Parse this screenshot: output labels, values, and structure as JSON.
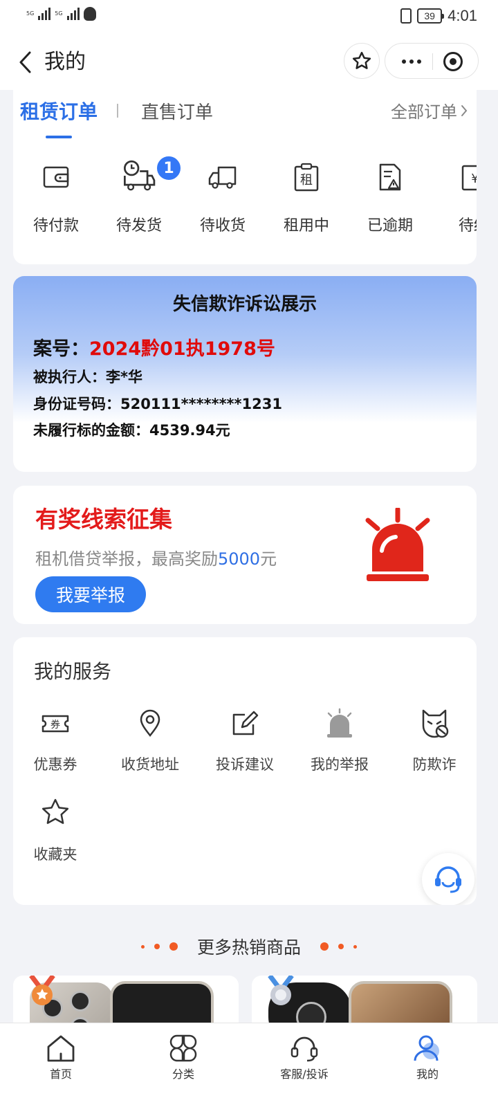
{
  "status_bar": {
    "net_tags": [
      "5G",
      "5G"
    ],
    "battery": "39",
    "time": "4:01"
  },
  "nav": {
    "title": "我的"
  },
  "orders": {
    "tabs": [
      "租赁订单",
      "直售订单"
    ],
    "all_orders_label": "全部订单",
    "items": [
      {
        "label": "待付款",
        "icon": "wallet-icon"
      },
      {
        "label": "待发货",
        "icon": "truck-clock-icon",
        "badge": "1"
      },
      {
        "label": "待收货",
        "icon": "truck-icon"
      },
      {
        "label": "租用中",
        "icon": "rent-clipboard-icon",
        "glyph": "租"
      },
      {
        "label": "已逾期",
        "icon": "overdue-document-icon"
      },
      {
        "label": "待结",
        "icon": "settlement-icon"
      }
    ]
  },
  "credit": {
    "title": "失信欺诈诉讼展示",
    "case_label": "案号：",
    "case_number": "2024黔01执1978号",
    "respondent": "被执行人：李*华",
    "id_number": "身份证号码：520111********1231",
    "amount": "未履行标的金额：4539.94元"
  },
  "reward": {
    "title": "有奖线索征集",
    "subtitle_prefix": "租机借贷举报，最高奖励",
    "subtitle_amount": "5000",
    "subtitle_suffix": "元",
    "button": "我要举报"
  },
  "services": {
    "title": "我的服务",
    "items": [
      {
        "label": "优惠券",
        "icon": "coupon-icon",
        "glyph": "券"
      },
      {
        "label": "收货地址",
        "icon": "location-pin-icon"
      },
      {
        "label": "投诉建议",
        "icon": "edit-complaint-icon"
      },
      {
        "label": "我的举报",
        "icon": "siren-icon"
      },
      {
        "label": "防欺诈",
        "icon": "anti-fraud-icon"
      },
      {
        "label": "收藏夹",
        "icon": "star-icon"
      }
    ]
  },
  "hot": {
    "title": "更多热销商品"
  },
  "tab_bar": {
    "items": [
      {
        "label": "首页",
        "icon": "home-icon"
      },
      {
        "label": "分类",
        "icon": "category-icon"
      },
      {
        "label": "客服/投诉",
        "icon": "headset-icon"
      },
      {
        "label": "我的",
        "icon": "profile-icon",
        "active": true
      }
    ]
  },
  "colors": {
    "accent": "#2b6fe6",
    "alert_red": "#e00b0b",
    "badge_blue": "#3478f6"
  }
}
